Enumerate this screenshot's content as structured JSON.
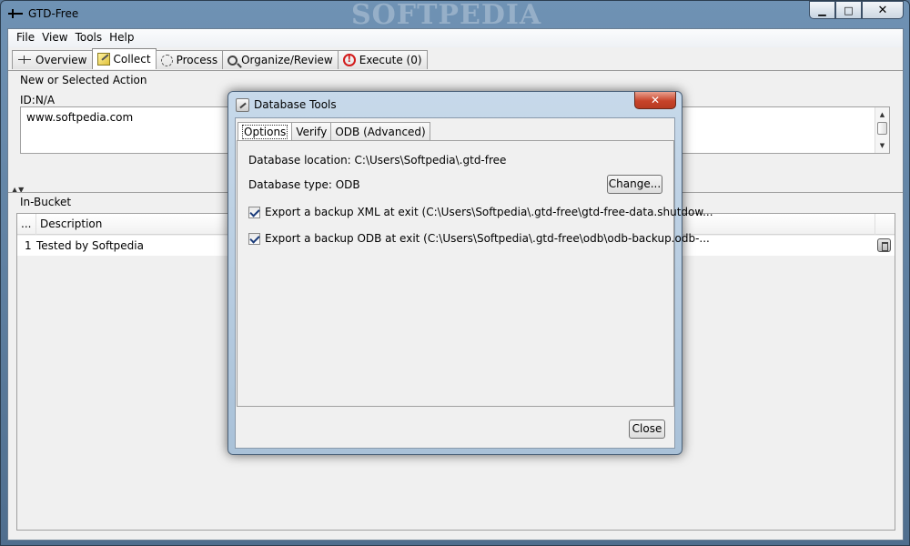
{
  "window": {
    "title": "GTD-Free",
    "watermark": "SOFTPEDIA",
    "caption": {
      "minimize": "▁",
      "maximize": "□",
      "close": "✕"
    }
  },
  "menu": [
    "File",
    "View",
    "Tools",
    "Help"
  ],
  "tabs": [
    {
      "label": "Overview",
      "icon": "overview-icon"
    },
    {
      "label": "Collect",
      "icon": "collect-icon",
      "active": true
    },
    {
      "label": "Process",
      "icon": "process-icon"
    },
    {
      "label": "Organize/Review",
      "icon": "organize-icon"
    },
    {
      "label": "Execute (0)",
      "icon": "execute-icon"
    }
  ],
  "collect": {
    "section_title": "New or Selected Action",
    "id_label": "ID:N/A",
    "text_value": "www.softpedia.com"
  },
  "inbucket": {
    "title": "In-Bucket",
    "columns": [
      "...",
      "Description"
    ],
    "rows": [
      {
        "num": "1",
        "description": "Tested by Softpedia"
      }
    ]
  },
  "dialog": {
    "title": "Database Tools",
    "close_glyph": "✕",
    "tabs": [
      "Options",
      "Verify",
      "ODB (Advanced)"
    ],
    "db_location": "Database location: C:\\Users\\Softpedia\\.gtd-free",
    "db_type": "Database type: ODB",
    "change_button": "Change...",
    "export_xml": {
      "label": "Export a backup XML at exit (C:\\Users\\Softpedia\\.gtd-free\\gtd-free-data.shutdow...",
      "checked": true
    },
    "export_odb": {
      "label": "Export a backup ODB at exit (C:\\Users\\Softpedia\\.gtd-free\\odb\\odb-backup.odb-...",
      "checked": true
    },
    "close_button": "Close"
  }
}
